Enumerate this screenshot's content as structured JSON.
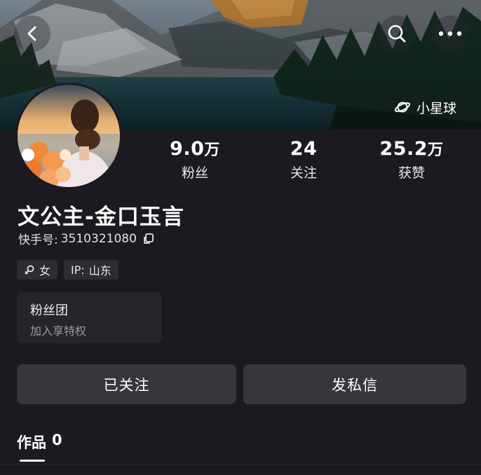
{
  "header": {
    "planet_label": "小星球"
  },
  "profile": {
    "name": "文公主-金口玉言",
    "id_label": "快手号:",
    "id_value": "3510321080",
    "gender": "女",
    "ip_label": "IP:",
    "ip_value": "山东"
  },
  "stats": [
    {
      "value": "9.0",
      "unit": "万",
      "label": "粉丝"
    },
    {
      "value": "24",
      "unit": "",
      "label": "关注"
    },
    {
      "value": "25.2",
      "unit": "万",
      "label": "获赞"
    }
  ],
  "fan_club": {
    "title": "粉丝团",
    "subtitle": "加入享特权"
  },
  "actions": {
    "follow_label": "已关注",
    "message_label": "发私信"
  },
  "tabs": {
    "works_label": "作品",
    "works_count": "0"
  },
  "icons": {
    "back": "back-arrow-icon",
    "search": "search-icon",
    "more": "more-icon",
    "planet": "planet-icon",
    "copy": "copy-icon",
    "gender": "female-icon"
  },
  "colors": {
    "background": "#1b1a20",
    "button": "#37363d",
    "card": "#26252c"
  }
}
